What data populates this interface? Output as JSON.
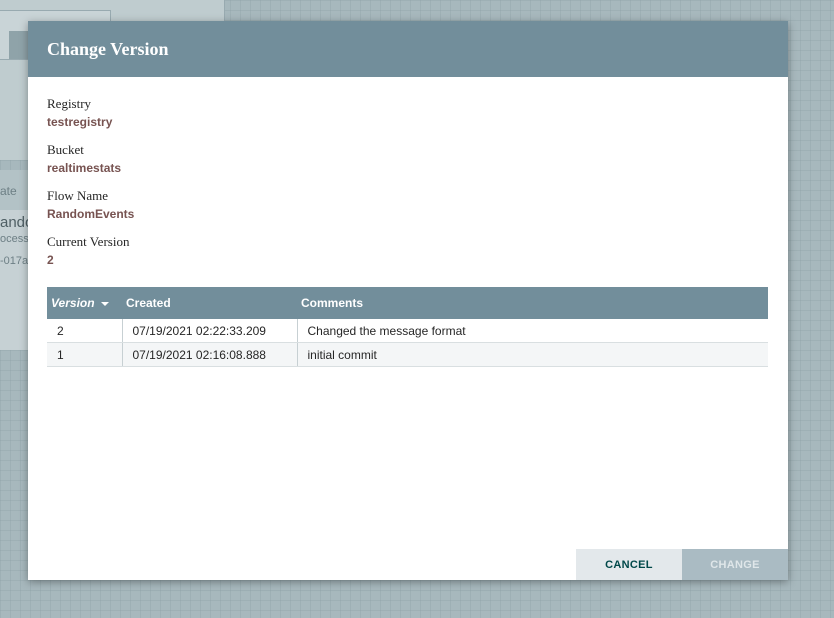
{
  "background": {
    "processor_label_1": "ate",
    "processor_name": "ando",
    "processor_type": "ocess",
    "processor_id": "-017a"
  },
  "dialog": {
    "title": "Change Version",
    "fields": [
      {
        "label": "Registry",
        "value": "testregistry"
      },
      {
        "label": "Bucket",
        "value": "realtimestats"
      },
      {
        "label": "Flow Name",
        "value": "RandomEvents"
      },
      {
        "label": "Current Version",
        "value": "2"
      }
    ],
    "table": {
      "columns": [
        "Version",
        "Created",
        "Comments"
      ],
      "rows": [
        {
          "version": "2",
          "created": "07/19/2021 02:22:33.209",
          "comments": "Changed the message format"
        },
        {
          "version": "1",
          "created": "07/19/2021 02:16:08.888",
          "comments": "initial commit"
        }
      ]
    },
    "buttons": {
      "cancel": "CANCEL",
      "change": "CHANGE"
    }
  },
  "colors": {
    "header": "#728e9b",
    "value_text": "#775351",
    "cancel_text": "#004849"
  }
}
